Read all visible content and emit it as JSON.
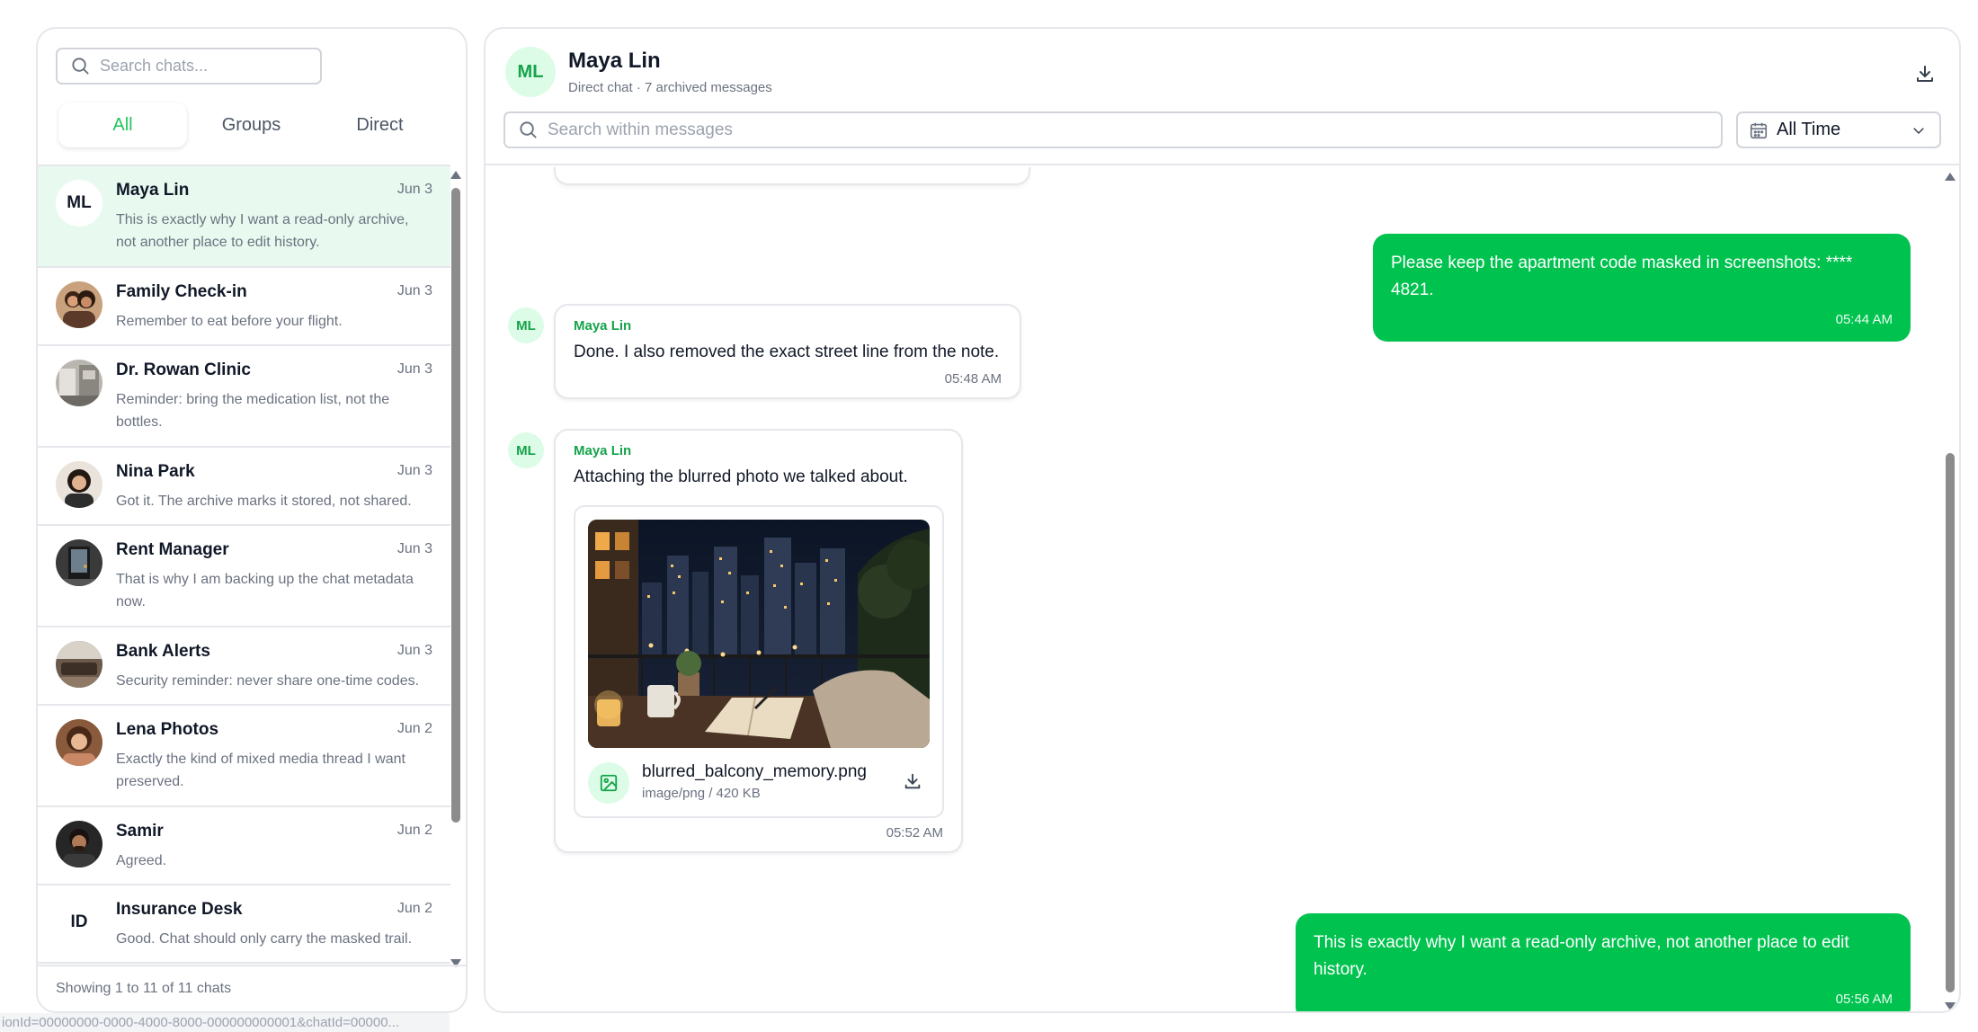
{
  "sidebar": {
    "search_placeholder": "Search chats...",
    "tabs": [
      {
        "label": "All",
        "active": true
      },
      {
        "label": "Groups",
        "active": false
      },
      {
        "label": "Direct",
        "active": false
      }
    ],
    "chats": [
      {
        "name": "Maya Lin",
        "date": "Jun 3",
        "preview": "This is exactly why I want a read-only archive, not another place to edit history.",
        "avatar": "ML"
      },
      {
        "name": "Family Check-in",
        "date": "Jun 3",
        "preview": "Remember to eat before your flight.",
        "avatar": "photo"
      },
      {
        "name": "Dr. Rowan Clinic",
        "date": "Jun 3",
        "preview": "Reminder: bring the medication list, not the bottles.",
        "avatar": "photo"
      },
      {
        "name": "Nina Park",
        "date": "Jun 3",
        "preview": "Got it. The archive marks it stored, not shared.",
        "avatar": "photo"
      },
      {
        "name": "Rent Manager",
        "date": "Jun 3",
        "preview": "That is why I am backing up the chat metadata now.",
        "avatar": "photo"
      },
      {
        "name": "Bank Alerts",
        "date": "Jun 3",
        "preview": "Security reminder: never share one-time codes.",
        "avatar": "photo"
      },
      {
        "name": "Lena Photos",
        "date": "Jun 2",
        "preview": "Exactly the kind of mixed media thread I want preserved.",
        "avatar": "photo"
      },
      {
        "name": "Samir",
        "date": "Jun 2",
        "preview": "Agreed.",
        "avatar": "photo"
      },
      {
        "name": "Insurance Desk",
        "date": "Jun 2",
        "preview": "Good. Chat should only carry the masked trail.",
        "avatar": "ID"
      }
    ],
    "footer": "Showing 1 to 11 of 11 chats"
  },
  "header": {
    "avatar": "ML",
    "name": "Maya Lin",
    "subtitle": "Direct chat · 7 archived messages",
    "search_placeholder": "Search within messages",
    "time_filter": "All Time"
  },
  "messages": [
    {
      "direction": "out",
      "text": "Please keep the apartment code masked in screenshots: **** 4821.",
      "time": "05:44 AM"
    },
    {
      "direction": "in",
      "avatar": "ML",
      "sender": "Maya Lin",
      "text": "Done. I also removed the exact street line from the note.",
      "time": "05:48 AM"
    },
    {
      "direction": "in",
      "avatar": "ML",
      "sender": "Maya Lin",
      "text": "Attaching the blurred photo we talked about.",
      "time": "05:52 AM",
      "attachment": {
        "file_name": "blurred_balcony_memory.png",
        "file_info": "image/png / 420 KB"
      }
    },
    {
      "direction": "out",
      "text": "This is exactly why I want a read-only archive, not another place to edit history.",
      "time": "05:56 AM"
    }
  ],
  "status_bar": "ionId=00000000-0000-4000-8000-000000000001&chatId=00000...",
  "colors": {
    "accent": "#00c24f",
    "accent_text": "#16a34a",
    "active_row": "#e8faef",
    "avatar_bg": "#dcfce7"
  }
}
